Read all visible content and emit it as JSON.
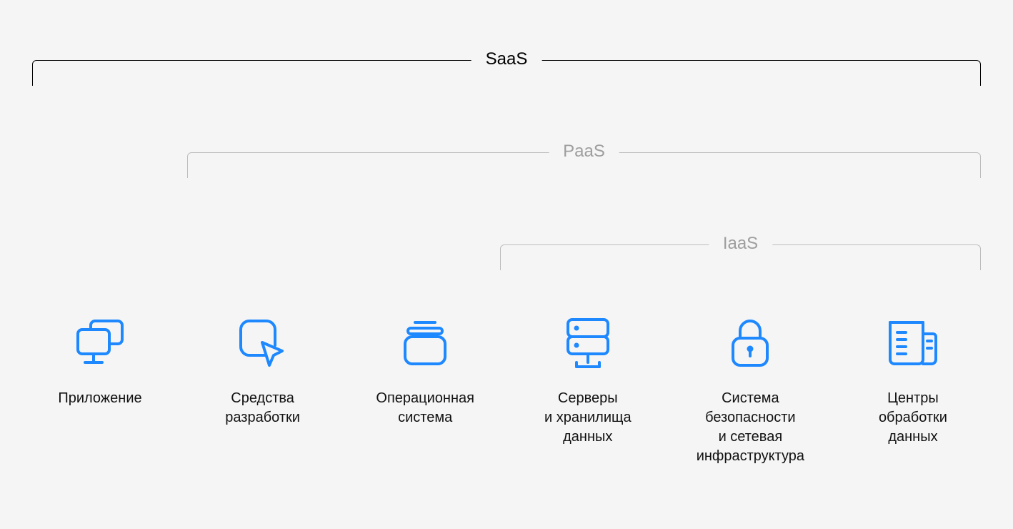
{
  "brackets": {
    "saas": {
      "label": "SaaS"
    },
    "paas": {
      "label": "PaaS"
    },
    "iaas": {
      "label": "IaaS"
    }
  },
  "items": [
    {
      "label": "Приложение"
    },
    {
      "label": "Средства\nразработки"
    },
    {
      "label": "Операционная\nсистема"
    },
    {
      "label": "Серверы\nи хранилища\nданных"
    },
    {
      "label": "Система\nбезопасности\nи сетевая\nинфраструктура"
    },
    {
      "label": "Центры\nобработки\nданных"
    }
  ],
  "colors": {
    "icon": "#1e88ff",
    "bracket_primary": "#000000",
    "bracket_secondary": "#bdbdbd",
    "text_secondary": "#9e9e9e"
  }
}
